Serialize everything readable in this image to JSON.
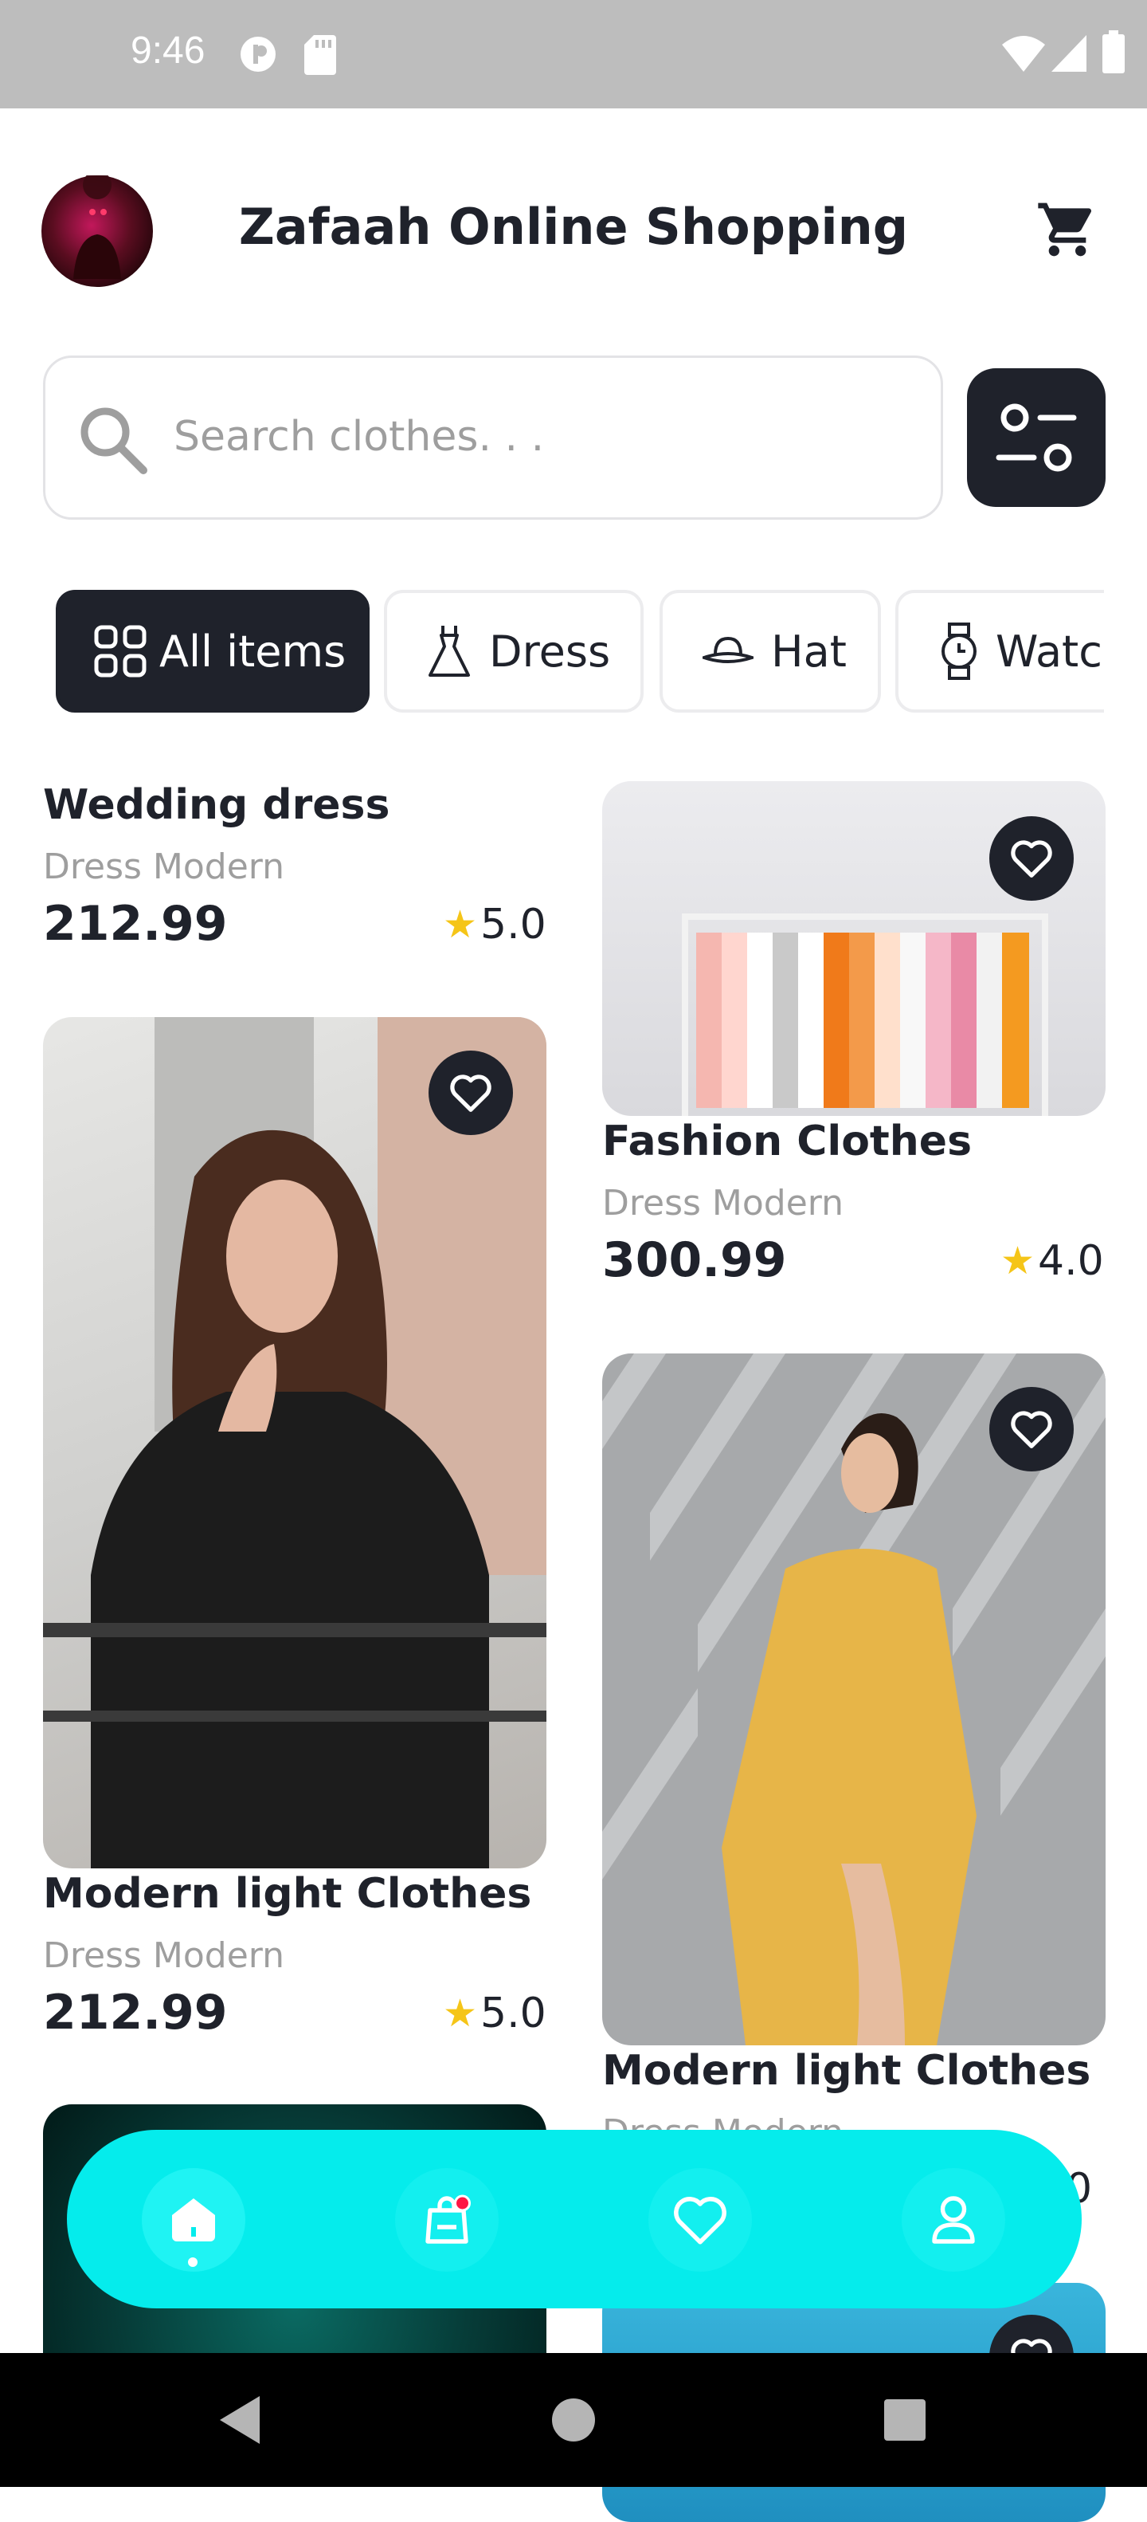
{
  "status_bar": {
    "time": "9:46"
  },
  "header": {
    "title": "Zafaah Online Shopping",
    "avatar_icon": "user-avatar",
    "cart_icon": "cart-icon"
  },
  "search": {
    "placeholder": "Search clothes. . .",
    "value": ""
  },
  "categories": [
    {
      "label": "All items",
      "icon": "grid-icon",
      "active": true
    },
    {
      "label": "Dress",
      "icon": "dress-icon",
      "active": false
    },
    {
      "label": "Hat",
      "icon": "hat-icon",
      "active": false
    },
    {
      "label": "Watch",
      "icon": "watch-icon",
      "active": false
    }
  ],
  "products": [
    {
      "name": "Wedding dress",
      "subtitle": "Dress Modern",
      "price": "212.99",
      "rating": "5.0"
    },
    {
      "name": "Fashion Clothes",
      "subtitle": "Dress Modern",
      "price": "300.99",
      "rating": "4.0"
    },
    {
      "name": "Modern light Clothes",
      "subtitle": "Dress Modern",
      "price": "212.99",
      "rating": "5.0"
    },
    {
      "name": "Modern light Clothes",
      "subtitle": "Dress Modern",
      "price": "",
      "rating": "0"
    }
  ],
  "bottom_nav": [
    {
      "icon": "home-icon",
      "active": true
    },
    {
      "icon": "shopping-bag-icon",
      "active": false,
      "badge": true
    },
    {
      "icon": "heart-icon",
      "active": false
    },
    {
      "icon": "profile-icon",
      "active": false
    }
  ],
  "colors": {
    "primary_dark": "#1f222b",
    "accent_cyan": "#05ecec",
    "star": "#f5c518",
    "badge": "#ff1744",
    "status_bar": "#bdbdbd"
  }
}
